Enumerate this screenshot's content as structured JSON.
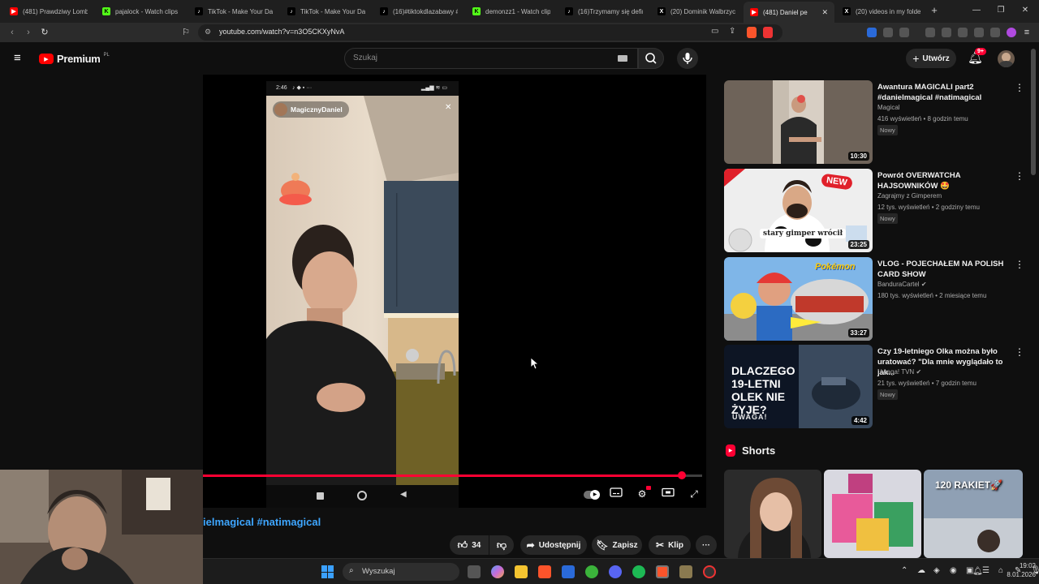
{
  "browser": {
    "tabs": [
      {
        "title": "(481) Prawdziwy Lomb",
        "icon": "youtube-icon",
        "color": "#ff0000"
      },
      {
        "title": "pajalock - Watch clips",
        "icon": "kick-icon",
        "color": "#53fc18"
      },
      {
        "title": "TikTok - Make Your Da",
        "icon": "tiktok-icon",
        "color": "#ffffff"
      },
      {
        "title": "TikTok - Make Your Da",
        "icon": "tiktok-icon",
        "color": "#ffffff"
      },
      {
        "title": "(16)#tiktokdlazabawy #",
        "icon": "tiktok-icon",
        "color": "#ffffff"
      },
      {
        "title": "demonzz1 - Watch clip",
        "icon": "kick-icon",
        "color": "#53fc18"
      },
      {
        "title": "(16)Trzymamy się defin",
        "icon": "tiktok-icon",
        "color": "#ffffff"
      },
      {
        "title": "(20) Dominik Walbrzyc",
        "icon": "x-icon",
        "color": "#ffffff"
      },
      {
        "title": "(481) Daniel pe",
        "icon": "youtube-icon",
        "color": "#ff0000",
        "active": true
      },
      {
        "title": "(20) videos in my folde",
        "icon": "x-icon",
        "color": "#ffffff"
      }
    ],
    "url": "youtube.com/watch?v=n3O5CKXyNvA"
  },
  "youtube": {
    "logo_text": "Premium",
    "region": "PL",
    "search_placeholder": "Szukaj",
    "create_label": "Utwórz",
    "notif_count": "9+",
    "accent": "#ff0033"
  },
  "player": {
    "phone_time": "2:46",
    "tiktok_user": "MagicznyDaniel",
    "progress_percent": 96,
    "title_visible": "ielmagical #natimagical"
  },
  "actions": {
    "like_count": "34",
    "share_label": "Udostępnij",
    "save_label": "Zapisz",
    "clip_label": "Klip"
  },
  "recommendations": [
    {
      "title": "Awantura MAGICALI part2 #danielmagical #natimagical",
      "channel": "Magical",
      "meta": "416 wyświetleń • 8 godzin temu",
      "badge": "Nowy",
      "duration": "10:30",
      "verified": false
    },
    {
      "title": "Powrót OVERWATCHA HAJSOWNIKÓW 🤩",
      "channel": "Zagrajmy z Gimperem",
      "meta": "12 tys. wyświetleń • 2 godziny temu",
      "badge": "Nowy",
      "duration": "23:25",
      "verified": false,
      "thumb_text": "stary gimper wrócił",
      "thumb_badge": "NEW"
    },
    {
      "title": "VLOG - POJECHAŁEM NA POLISH CARD SHOW",
      "channel": "BanduraCartel",
      "meta": "180 tys. wyświetleń • 2 miesiące temu",
      "badge": "",
      "duration": "33:27",
      "verified": true
    },
    {
      "title": "Czy 19-letniego Olka można było uratować? \"Dla mnie wyglądało to jak...",
      "channel": "Uwaga! TVN",
      "meta": "21 tys. wyświetleń • 7 godzin temu",
      "badge": "Nowy",
      "duration": "4:42",
      "verified": true,
      "thumb_text": "DLACZEGO 19-LETNI OLEK NIE ŻYJE?",
      "thumb_logo": "UWAGA!"
    }
  ],
  "shorts": {
    "heading": "Shorts",
    "items": [
      {
        "caption": ""
      },
      {
        "caption": ""
      },
      {
        "caption": "120 RAKIET🚀"
      }
    ]
  },
  "taskbar": {
    "search_placeholder": "Wyszukaj",
    "time": "19:02",
    "date": "8.01.2026"
  }
}
